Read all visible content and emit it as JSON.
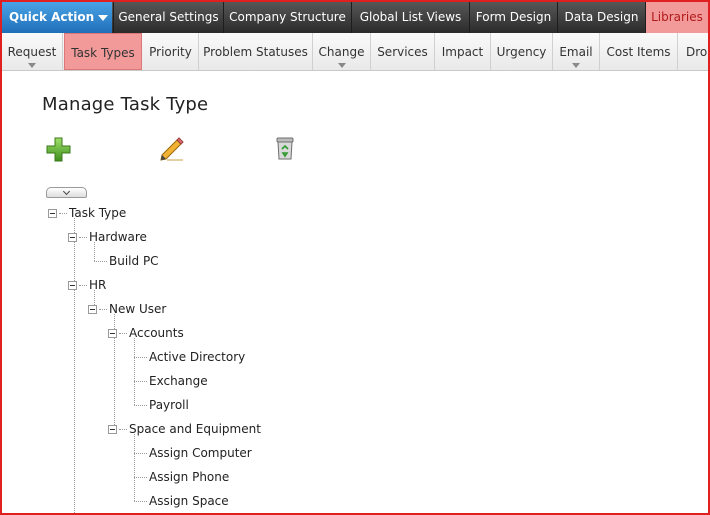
{
  "top_nav": {
    "quick_action": "Quick Action",
    "tabs": [
      "General Settings",
      "Company Structure",
      "Global List Views",
      "Form Design",
      "Data Design",
      "Libraries"
    ]
  },
  "sub_nav": {
    "tabs": [
      "Request",
      "Task Types",
      "Priority",
      "Problem Statuses",
      "Change",
      "Services",
      "Impact",
      "Urgency",
      "Email",
      "Cost Items",
      "Drop"
    ]
  },
  "page": {
    "title": "Manage Task Type"
  },
  "toolbar": {
    "add": "add-icon",
    "edit": "pencil-icon",
    "delete": "recycle-bin-icon"
  },
  "tree": {
    "root": "Task Type",
    "hardware": "Hardware",
    "build_pc": "Build PC",
    "hr": "HR",
    "new_user": "New User",
    "accounts": "Accounts",
    "active_directory": "Active Directory",
    "exchange": "Exchange",
    "payroll": "Payroll",
    "space_equipment": "Space and Equipment",
    "assign_computer": "Assign Computer",
    "assign_phone": "Assign Phone",
    "assign_space": "Assign Space"
  },
  "colors": {
    "accent": "#f29a9a",
    "quick_action": "#2f86d2",
    "frame": "#e02020"
  }
}
